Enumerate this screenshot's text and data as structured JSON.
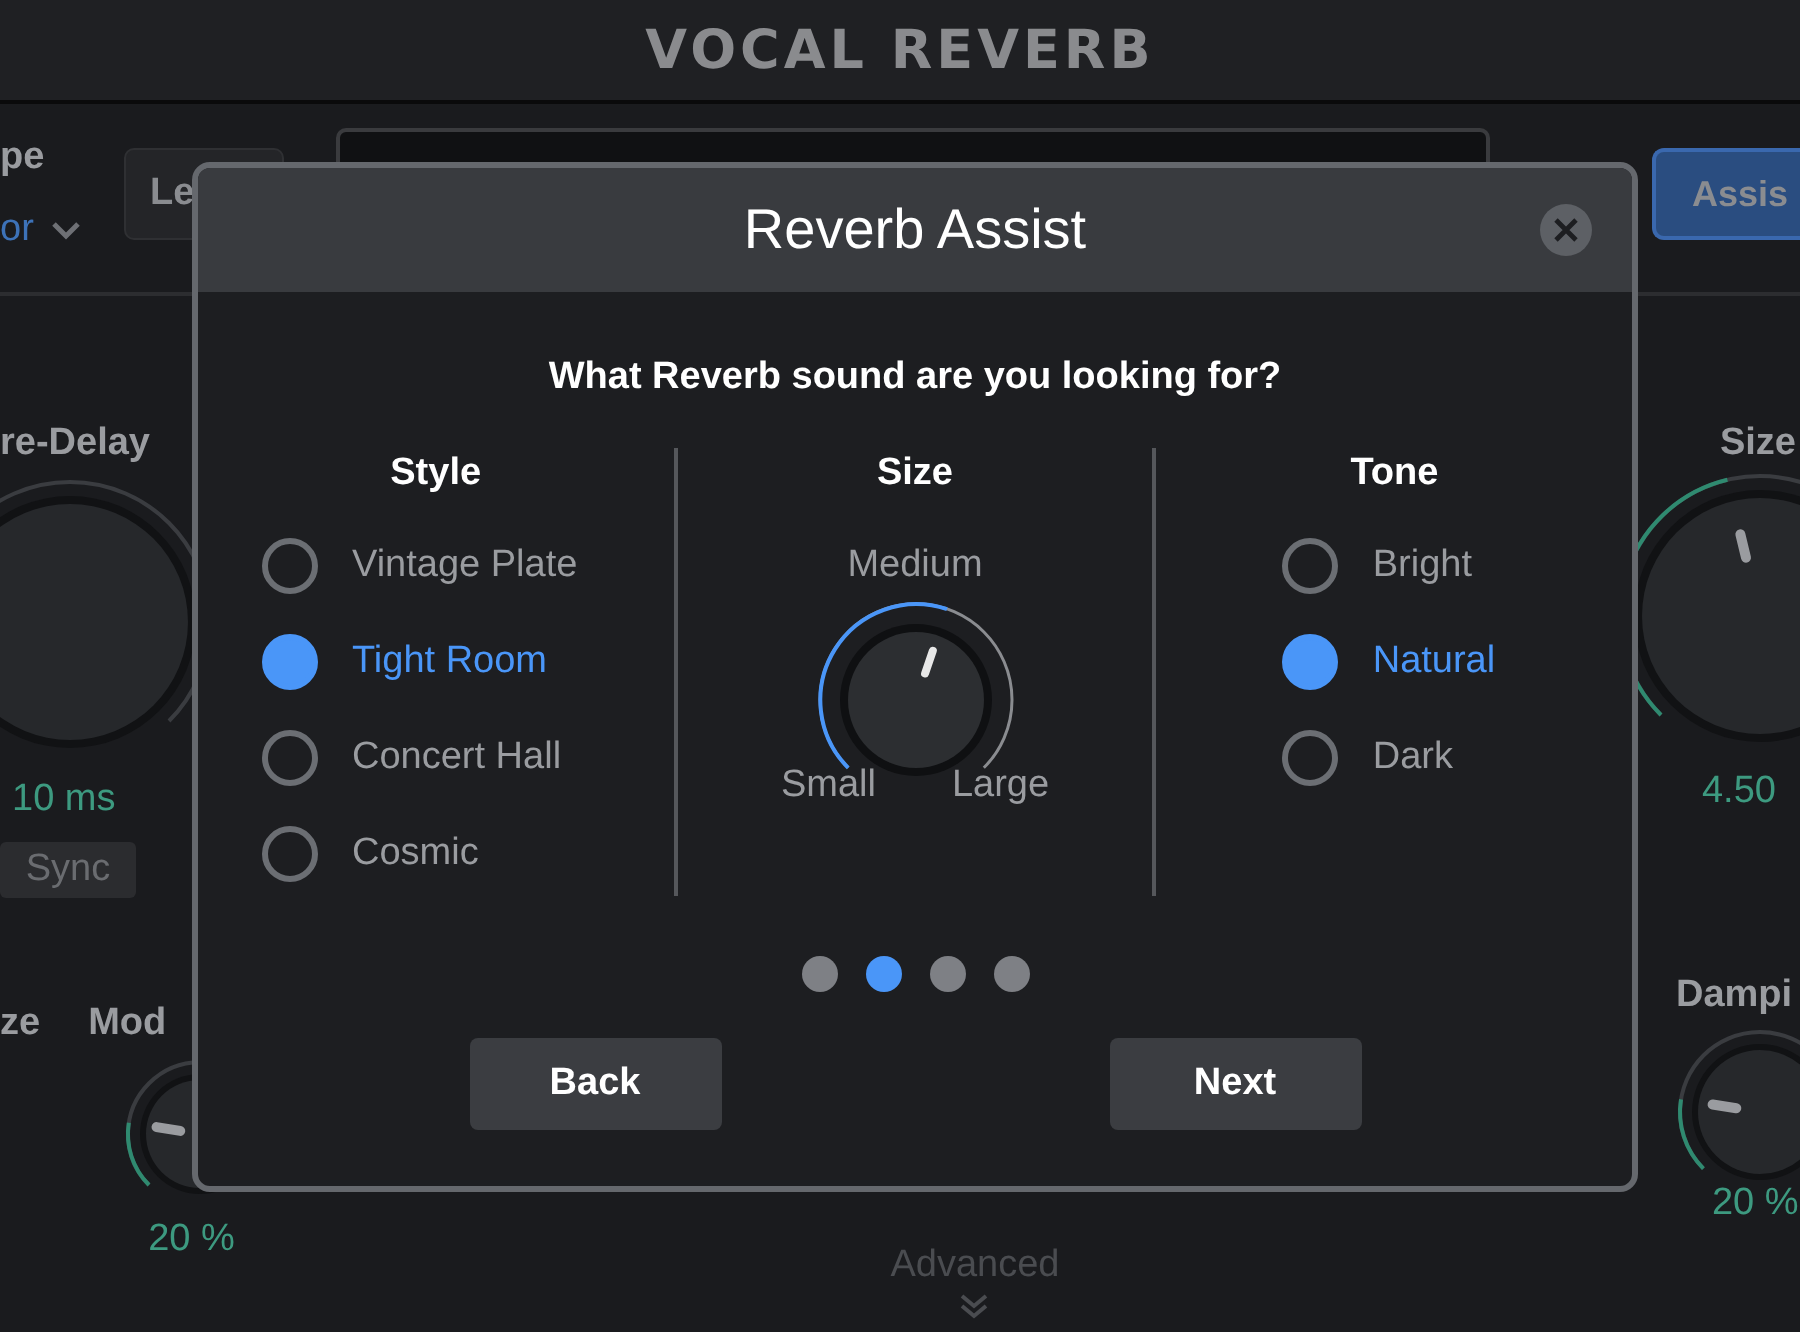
{
  "plugin": {
    "title": "VOCAL REVERB",
    "type_label": "pe",
    "type_value": "or",
    "level_button": "Le",
    "assist_button": "Assis",
    "pre_delay": {
      "label": "re-Delay",
      "value": "10 ms",
      "sync_button": "Sync"
    },
    "left_bottom_label": "ze",
    "mod": {
      "label": "Mod",
      "value": "20 %"
    },
    "size": {
      "label": "Size",
      "value": "4.50"
    },
    "damping": {
      "label": "Dampi",
      "value": "20 %"
    },
    "advanced": "Advanced"
  },
  "dialog": {
    "title": "Reverb Assist",
    "question": "What Reverb sound are you looking for?",
    "style": {
      "heading": "Style",
      "options": [
        {
          "label": "Vintage Plate",
          "selected": false
        },
        {
          "label": "Tight Room",
          "selected": true
        },
        {
          "label": "Concert Hall",
          "selected": false
        },
        {
          "label": "Cosmic",
          "selected": false
        }
      ]
    },
    "size": {
      "heading": "Size",
      "value_label": "Medium",
      "min_label": "Small",
      "max_label": "Large"
    },
    "tone": {
      "heading": "Tone",
      "options": [
        {
          "label": "Bright",
          "selected": false
        },
        {
          "label": "Natural",
          "selected": true
        },
        {
          "label": "Dark",
          "selected": false
        }
      ]
    },
    "pages": [
      {
        "selected": false
      },
      {
        "selected": true
      },
      {
        "selected": false
      },
      {
        "selected": false
      }
    ],
    "buttons": [
      "Back",
      "Next"
    ]
  }
}
